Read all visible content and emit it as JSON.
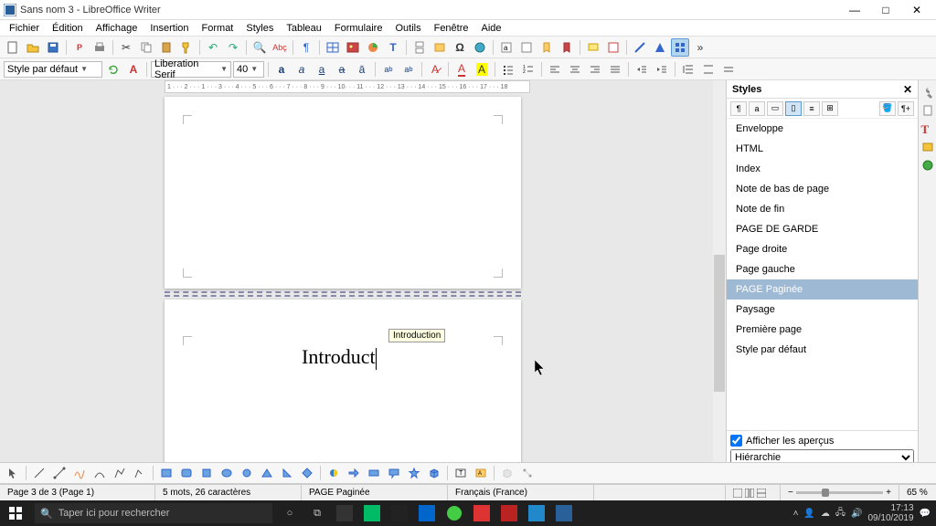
{
  "window": {
    "title": "Sans nom 3 - LibreOffice Writer"
  },
  "menu": {
    "items": [
      "Fichier",
      "Édition",
      "Affichage",
      "Insertion",
      "Format",
      "Styles",
      "Tableau",
      "Formulaire",
      "Outils",
      "Fenêtre",
      "Aide"
    ]
  },
  "format": {
    "para_style": "Style par défaut",
    "font_name": "Liberation Serif",
    "font_size": "40"
  },
  "ruler": "1 · · · 2 · · · 1 · · · 3 · · · 4 · · · 5 · · · 6 · · · 7 · · · 8 · · · 9 · · · 10· · · 11 · · · 12 · · · 13 · · · 14 · · · 15 · · · 16 · · · 17 · · · 18",
  "document": {
    "text": "Introduct",
    "tooltip": "Introduction"
  },
  "styles": {
    "title": "Styles",
    "items": [
      "Enveloppe",
      "HTML",
      "Index",
      "Note de bas de page",
      "Note de fin",
      "PAGE DE GARDE",
      "Page droite",
      "Page gauche",
      "PAGE Paginée",
      "Paysage",
      "Première page",
      "Style par défaut"
    ],
    "selected_index": 8,
    "show_preview_label": "Afficher les aperçus",
    "mode": "Hiérarchie"
  },
  "status": {
    "page": "Page 3 de 3 (Page 1)",
    "words": "5 mots, 26 caractères",
    "style": "PAGE Paginée",
    "lang": "Français (France)",
    "zoom": "65 %"
  },
  "taskbar": {
    "search_placeholder": "Taper ici pour rechercher",
    "time": "17:13",
    "date": "09/10/2019"
  }
}
